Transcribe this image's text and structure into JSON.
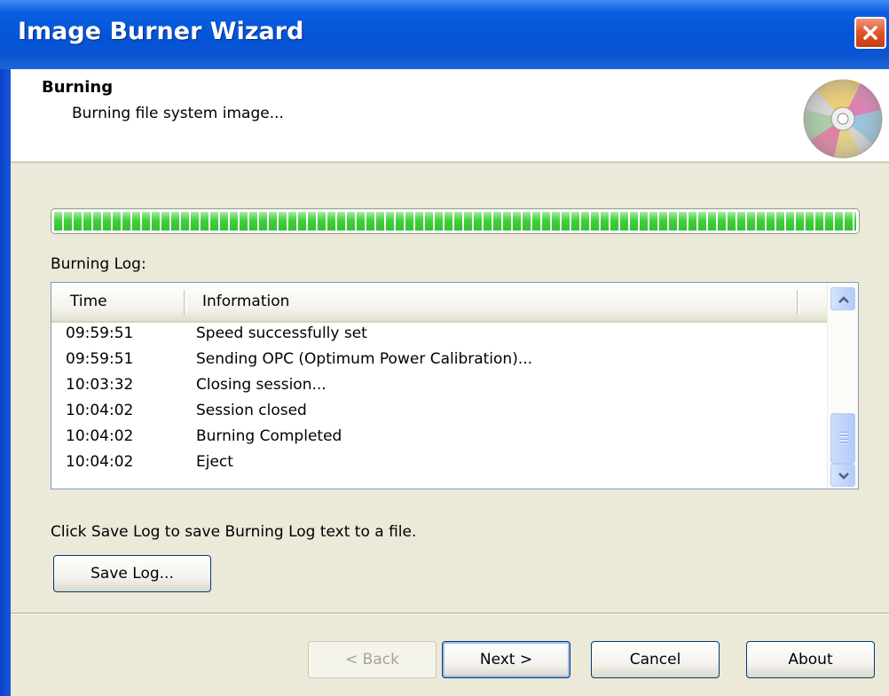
{
  "window": {
    "title": "Image Burner Wizard"
  },
  "header": {
    "title": "Burning",
    "subtitle": "Burning file system image..."
  },
  "progress": {
    "percent": 100,
    "color": "#3fd23a"
  },
  "log": {
    "label": "Burning Log:",
    "columns": {
      "time": "Time",
      "info": "Information"
    },
    "rows": [
      {
        "time": "09:59:51",
        "info": "Speed successfully set"
      },
      {
        "time": "09:59:51",
        "info": "Sending OPC (Optimum Power Calibration)..."
      },
      {
        "time": "10:03:32",
        "info": "Closing session..."
      },
      {
        "time": "10:04:02",
        "info": "Session closed"
      },
      {
        "time": "10:04:02",
        "info": "Burning Completed"
      },
      {
        "time": "10:04:02",
        "info": "Eject"
      }
    ]
  },
  "hint": "Click Save Log to save Burning Log text to a file.",
  "buttons": {
    "save_log": "Save Log...",
    "back": "< Back",
    "next": "Next >",
    "cancel": "Cancel",
    "about": "About"
  },
  "icons": {
    "close": "close-icon",
    "disc": "disc-icon",
    "scroll_up": "chevron-up-icon",
    "scroll_down": "chevron-down-icon"
  },
  "colors": {
    "titlebar": "#0454d6",
    "close": "#e2582e",
    "dialog_bg": "#ece9d8"
  }
}
